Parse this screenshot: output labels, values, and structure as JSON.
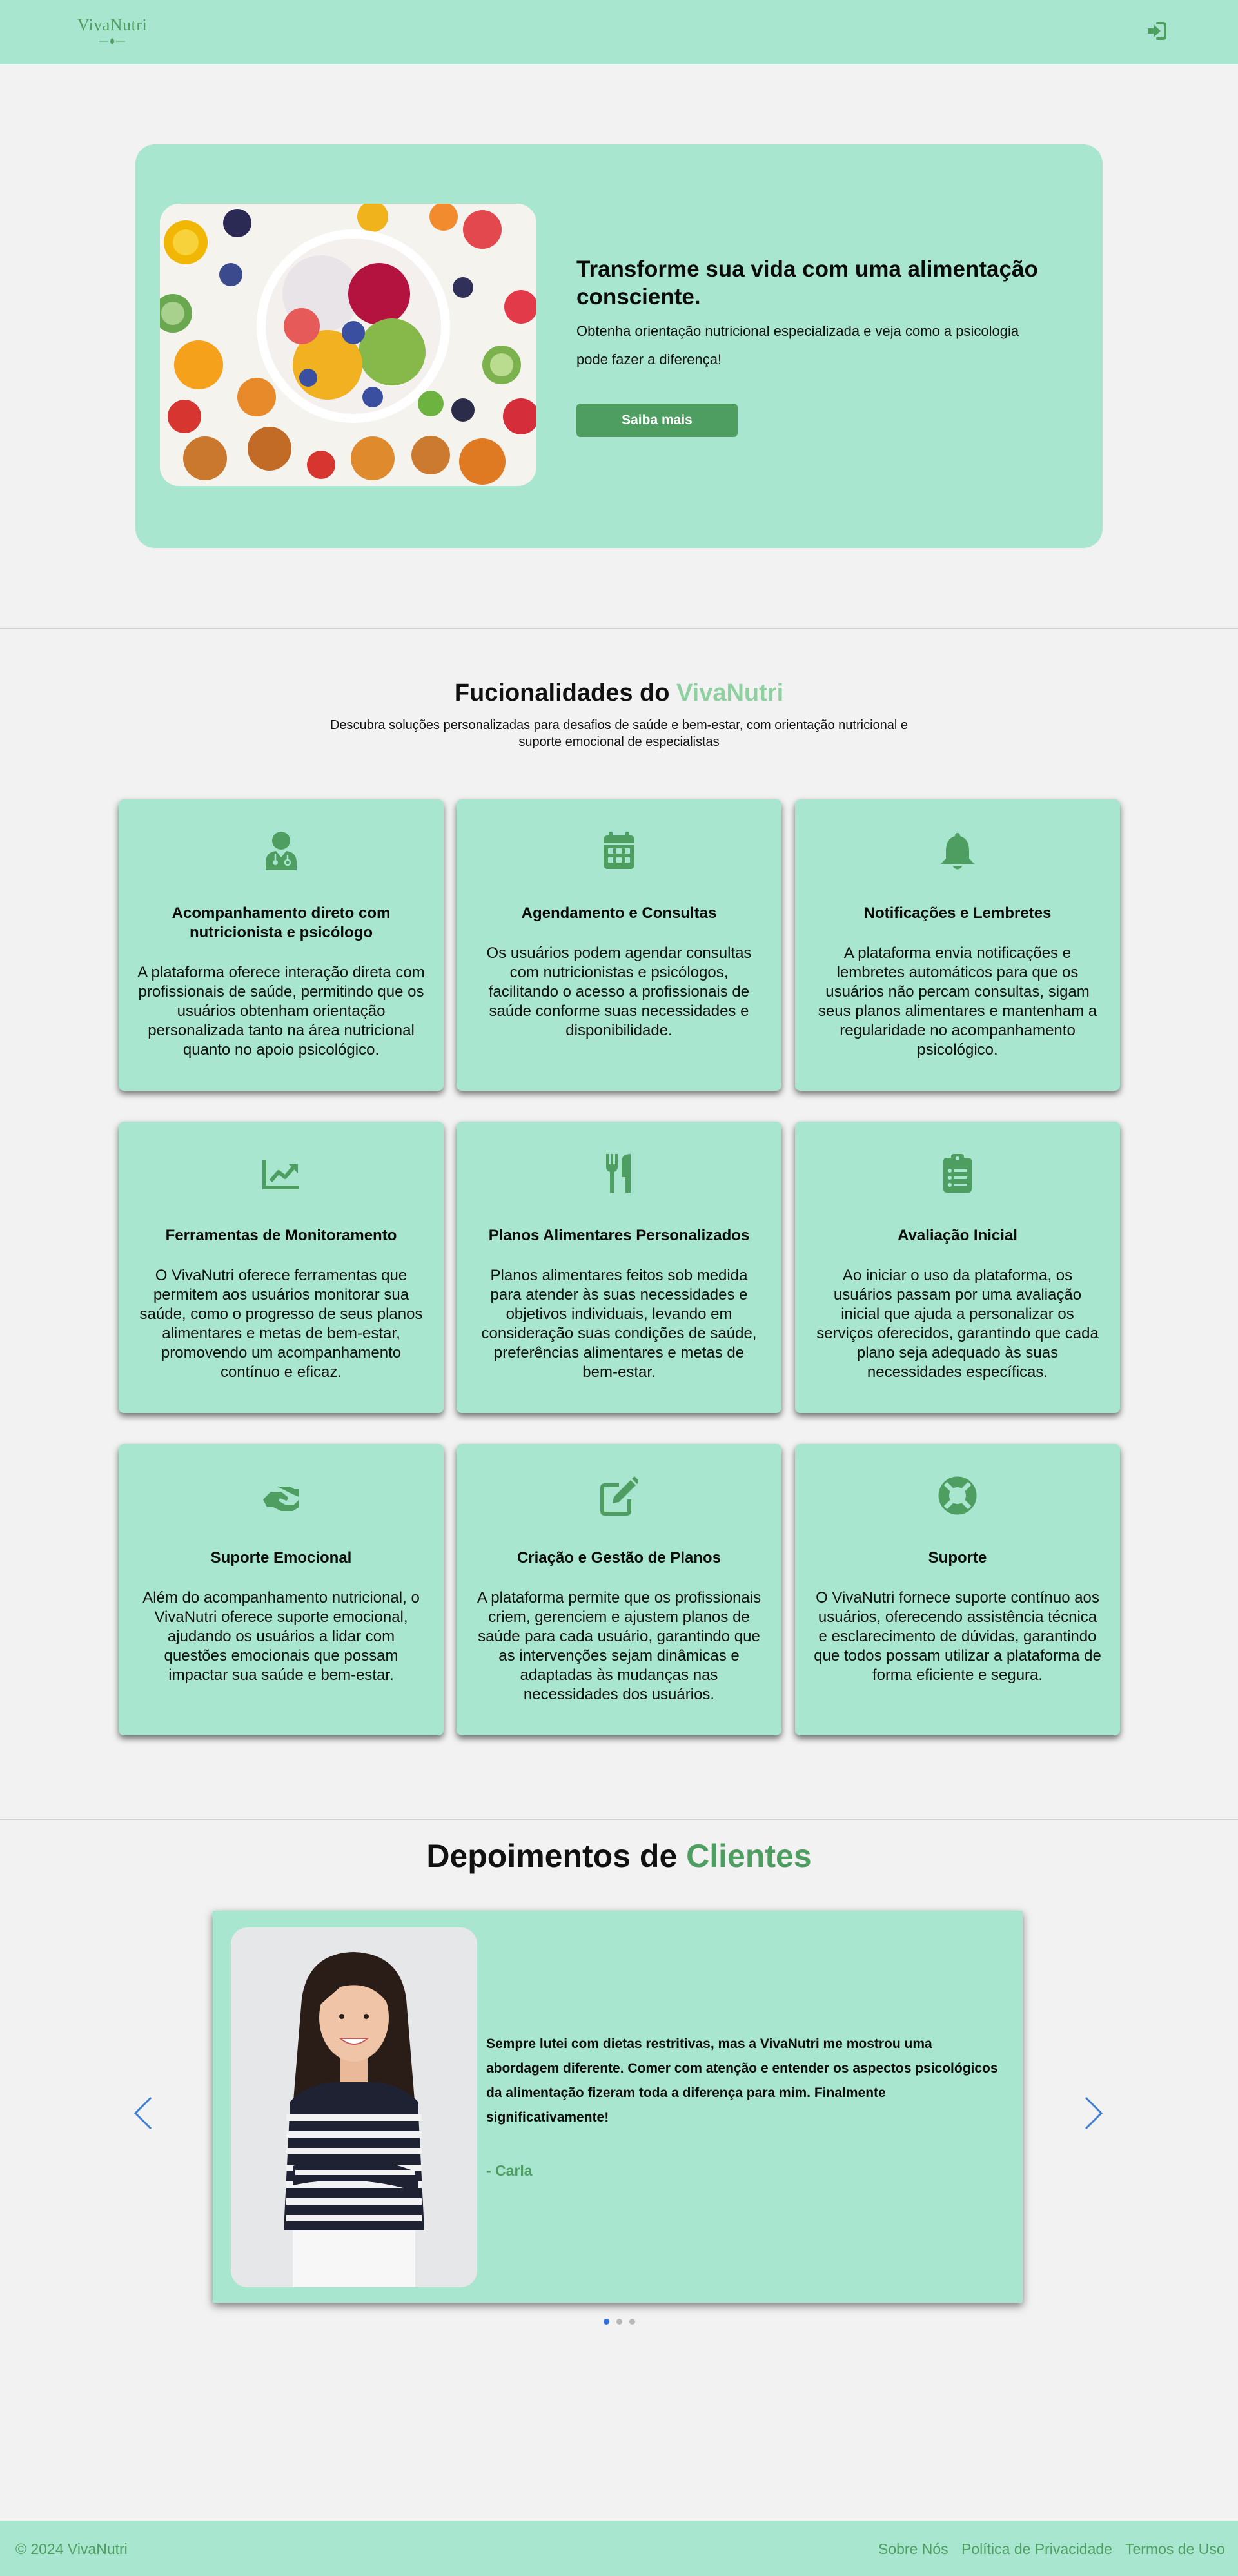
{
  "header": {
    "logo_text": "VivaNutri",
    "login_icon": "sign-in-icon"
  },
  "hero": {
    "title": "Transforme sua vida com uma alimentação consciente.",
    "text": "Obtenha orientação nutricional especializada e veja como a psicologia pode fazer a diferença!",
    "button_label": "Saiba mais"
  },
  "features": {
    "title_prefix": "Fucionalidades do ",
    "title_highlight": "VivaNutri",
    "subtitle": "Descubra soluções personalizadas para desafios de saúde e bem-estar, com orientação nutricional e suporte emocional de especialistas",
    "cards": [
      {
        "icon": "doctor-icon",
        "title": "Acompanhamento direto com nutricionista e psicólogo",
        "text": "A plataforma oferece interação direta com profissionais de saúde, permitindo que os usuários obtenham orientação personalizada tanto na área nutricional quanto no apoio psicológico."
      },
      {
        "icon": "calendar-icon",
        "title": "Agendamento e Consultas",
        "text": "Os usuários podem agendar consultas com nutricionistas e psicólogos, facilitando o acesso a profissionais de saúde conforme suas necessidades e disponibilidade."
      },
      {
        "icon": "bell-icon",
        "title": "Notificações e Lembretes",
        "text": "A plataforma envia notificações e lembretes automáticos para que os usuários não percam consultas, sigam seus planos alimentares e mantenham a regularidade no acompanhamento psicológico."
      },
      {
        "icon": "chart-line-icon",
        "title": "Ferramentas de Monitoramento",
        "text": "O VivaNutri oferece ferramentas que permitem aos usuários monitorar sua saúde, como o progresso de seus planos alimentares e metas de bem-estar, promovendo um acompanhamento contínuo e eficaz."
      },
      {
        "icon": "utensils-icon",
        "title": "Planos Alimentares Personalizados",
        "text": "Planos alimentares feitos sob medida para atender às suas necessidades e objetivos individuais, levando em consideração suas condições de saúde, preferências alimentares e metas de bem-estar."
      },
      {
        "icon": "clipboard-list-icon",
        "title": "Avaliação Inicial",
        "text": "Ao iniciar o uso da plataforma, os usuários passam por uma avaliação inicial que ajuda a personalizar os serviços oferecidos, garantindo que cada plano seja adequado às suas necessidades específicas."
      },
      {
        "icon": "hands-helping-icon",
        "title": "Suporte Emocional",
        "text": "Além do acompanhamento nutricional, o VivaNutri oferece suporte emocional, ajudando os usuários a lidar com questões emocionais que possam impactar sua saúde e bem-estar."
      },
      {
        "icon": "edit-icon",
        "title": "Criação e Gestão de Planos",
        "text": "A plataforma permite que os profissionais criem, gerenciem e ajustem planos de saúde para cada usuário, garantindo que as intervenções sejam dinâmicas e adaptadas às mudanças nas necessidades dos usuários."
      },
      {
        "icon": "life-ring-icon",
        "title": "Suporte",
        "text": "O VivaNutri fornece suporte contínuo aos usuários, oferecendo assistência técnica e esclarecimento de dúvidas, garantindo que todos possam utilizar a plataforma de forma eficiente e segura."
      }
    ]
  },
  "testimonials": {
    "title_prefix": "Depoimentos de ",
    "title_highlight": "Clientes",
    "quote": "Sempre lutei com dietas restritivas, mas a VivaNutri me mostrou uma abordagem diferente. Comer com atenção e entender os aspectos psicológicos da alimentação fizeram toda a diferença para mim. Finalmente significativamente!",
    "author": "- Carla",
    "active_slide": 0,
    "slide_count": 3
  },
  "footer": {
    "copyright": "© 2024 VivaNutri",
    "links": [
      "Sobre Nós",
      "Política de Privacidade",
      "Termos de Uso"
    ]
  },
  "colors": {
    "mint": "#a8e6cf",
    "brand_green": "#4e9e62",
    "page_bg": "#f2f2f2",
    "arrow_blue": "#3d7fd6",
    "dot_active": "#2f6fe0"
  }
}
